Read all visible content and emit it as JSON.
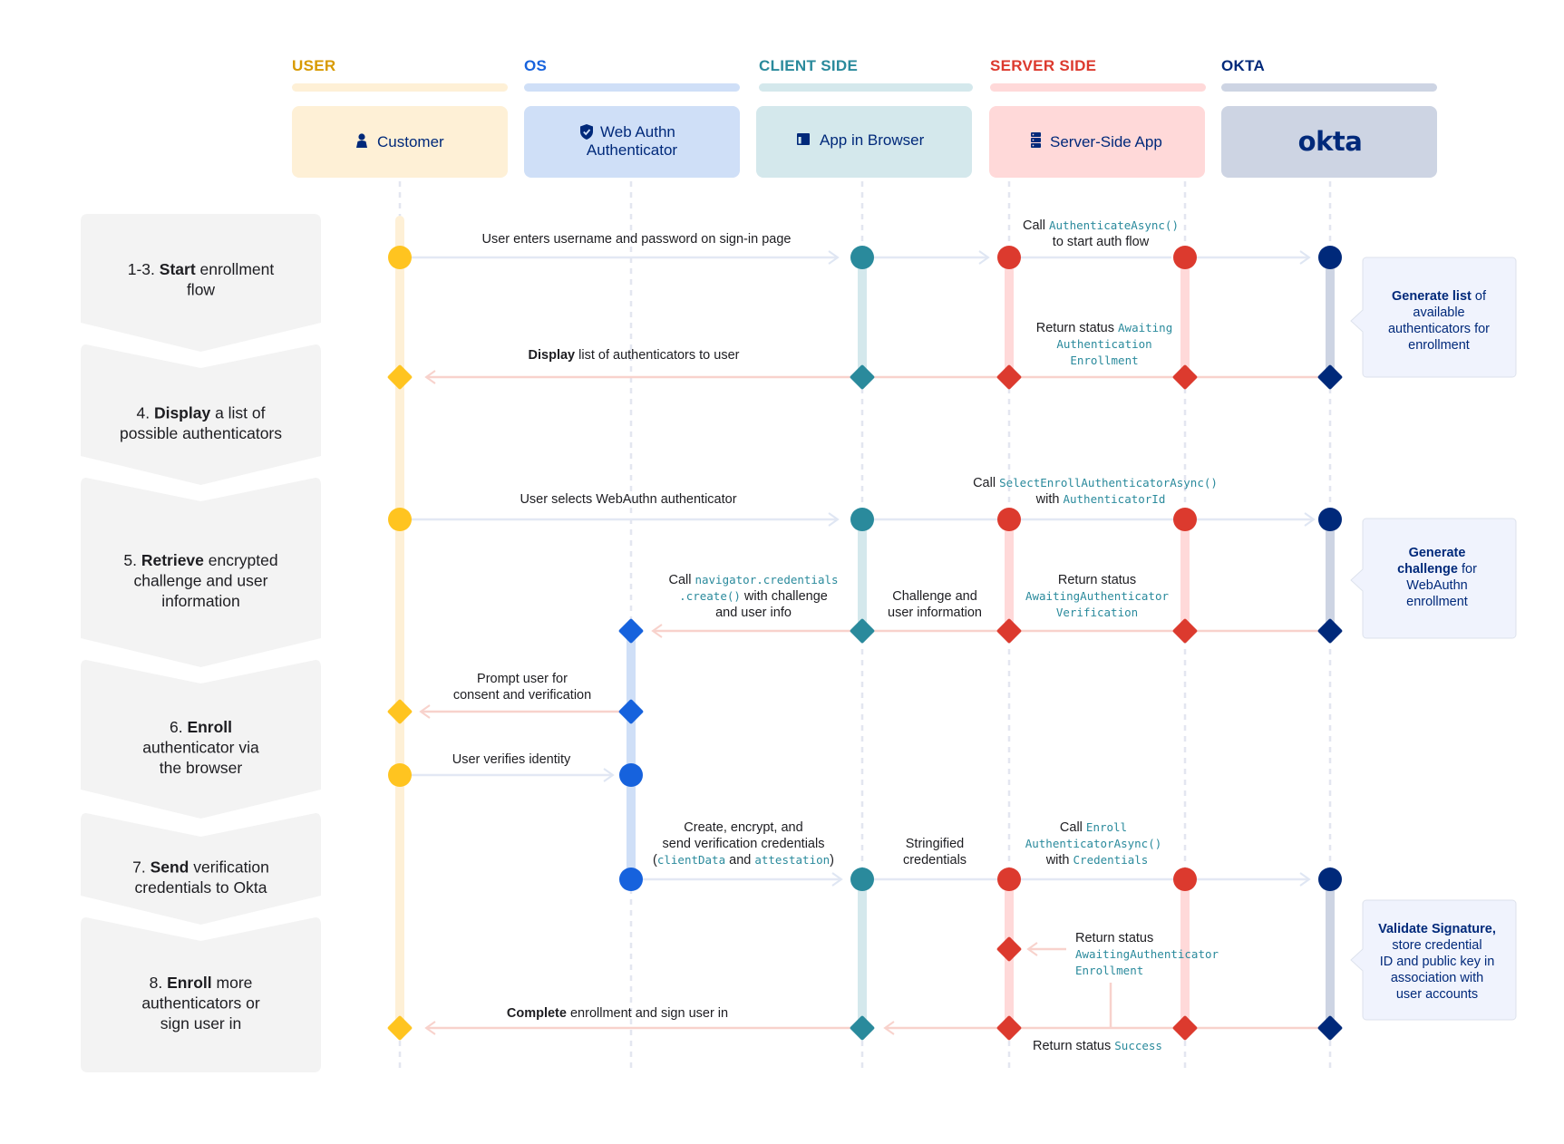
{
  "colors": {
    "user": "#ffc420",
    "user_light": "#fef0d6",
    "os": "#1662dd",
    "os_light": "#cfdff7",
    "client": "#2a8a9c",
    "client_light": "#d4e8ec",
    "server": "#dc3a2e",
    "server_light": "#ffd9d9",
    "okta": "#00297a",
    "okta_light": "#cdd4e3",
    "lane_title_user": "#d89a00",
    "lane_title_os": "#1662dd",
    "lane_title_client": "#2a8a9c",
    "lane_title_server": "#dc3a2e",
    "lane_title_okta": "#00297a",
    "step_bg": "#f3f3f3",
    "note_bg": "#f0f3fd",
    "arrow_forward": "#e3e8f4",
    "arrow_back": "#f8d2cc",
    "code": "#2a8a9c"
  },
  "lanes": [
    {
      "id": "user",
      "title": "USER",
      "actor": "Customer",
      "icon": "person-icon"
    },
    {
      "id": "os",
      "title": "OS",
      "actor_lines": [
        "Web Authn",
        "Authenticator"
      ],
      "icon": "shield-check-icon"
    },
    {
      "id": "client",
      "title": "CLIENT SIDE",
      "actor": "App in Browser",
      "icon": "browser-window-icon"
    },
    {
      "id": "server",
      "title": "SERVER SIDE",
      "actor": "Server-Side App",
      "icon": "server-icon"
    },
    {
      "id": "okta",
      "title": "OKTA",
      "actor": "okta",
      "icon": "okta-logo"
    }
  ],
  "steps": [
    {
      "num": "1-3.",
      "bold": "Start",
      "rest": " enrollment",
      "line2": "flow"
    },
    {
      "num": "4.",
      "bold": "Display",
      "rest": " a list of",
      "line2": "possible authenticators"
    },
    {
      "num": "5.",
      "bold": "Retrieve",
      "rest": " encrypted",
      "line2": "challenge and user",
      "line3": "information"
    },
    {
      "num": "6.",
      "bold": "Enroll",
      "rest": "",
      "line2": "authenticator via",
      "line3": "the browser"
    },
    {
      "num": "7.",
      "bold": "Send",
      "rest": " verification",
      "line2": "credentials to Okta"
    },
    {
      "num": "8.",
      "bold": "Enroll",
      "rest": " more",
      "line2": "authenticators or",
      "line3": "sign user in"
    }
  ],
  "messages": {
    "m1": "User enters username and password on sign-in page",
    "m2_call": "Call ",
    "m2_code": "AuthenticateAsync()",
    "m2_line2": "to start auth flow",
    "m3_text": "Return status ",
    "m3_code1": "Awaiting",
    "m3_code2": "Authentication",
    "m3_code3": "Enrollment",
    "m4_bold": "Display",
    "m4_rest": " list of authenticators to user",
    "m5": "User selects WebAuthn authenticator",
    "m6_call": "Call ",
    "m6_code": "SelectEnrollAuthenticatorAsync()",
    "m6_with": "with ",
    "m6_code2": "AuthenticatorId",
    "m7_text": "Return status",
    "m7_code1": "AwaitingAuthenticator",
    "m7_code2": "Verification",
    "m8_line1": "Challenge and",
    "m8_line2": "user information",
    "m9_call": "Call ",
    "m9_code1": "navigator.credentials",
    "m9_code2": ".create()",
    "m9_rest": " with challenge",
    "m9_line3": "and user info",
    "m10_line1": "Prompt user for",
    "m10_line2": "consent and verification",
    "m11": "User verifies identity",
    "m12_line1": "Create, encrypt, and",
    "m12_line2": "send verification credentials",
    "m12_open": "(",
    "m12_code1": "clientData",
    "m12_and": " and ",
    "m12_code2": "attestation",
    "m12_close": ")",
    "m13_line1": "Stringified",
    "m13_line2": "credentials",
    "m14_call": "Call ",
    "m14_code1": "Enroll",
    "m14_code2": "AuthenticatorAsync()",
    "m14_with": "with ",
    "m14_code3": "Credentials",
    "m15_text": "Return status",
    "m15_code1": "AwaitingAuthenticator",
    "m15_code2": "Enrollment",
    "m16_bold": "Complete",
    "m16_rest": " enrollment and sign user in",
    "m17_text": "Return status ",
    "m17_code": "Success"
  },
  "notes": [
    {
      "bold": "Generate list",
      "rest": " of",
      "lines": [
        "available",
        "authenticators for",
        "enrollment"
      ]
    },
    {
      "bold": "Generate",
      "bold2": "challenge",
      "rest": " for",
      "lines": [
        "WebAuthn",
        "enrollment"
      ]
    },
    {
      "bold": "Validate Signature,",
      "lines": [
        "store credential",
        "ID and public key in",
        "association with",
        "user accounts"
      ]
    }
  ]
}
